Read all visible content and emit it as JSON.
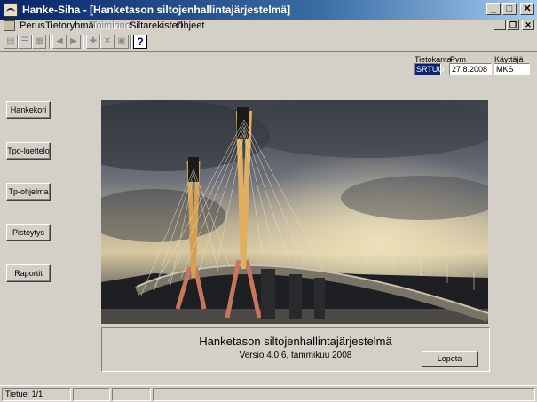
{
  "window": {
    "title": "Hanke-Siha - [Hanketason siltojenhallintajärjestelmä]",
    "app_icon": "bridge-app-icon",
    "controls": {
      "minimize": "_",
      "maximize": "□",
      "close": "✕"
    }
  },
  "menu": {
    "items": [
      "Perus",
      "Tietoryhmät",
      "Toiminnot",
      "Siltarekisteri",
      "Ohjeet"
    ],
    "disabled_item": "Toiminnot",
    "mdi_controls": {
      "minimize": "_",
      "restore": "❐",
      "close": "✕"
    }
  },
  "toolbar": {
    "icons": [
      "report-icon",
      "list-icon",
      "grid-icon",
      "prev-icon",
      "next-icon",
      "add-icon",
      "delete-icon",
      "save-icon",
      "help-icon"
    ],
    "glyphs": {
      "prev": "◀",
      "next": "▶",
      "add": "✚",
      "delete": "✕",
      "save": "▣",
      "help": "?"
    }
  },
  "session": {
    "database_label": "Tietokanta",
    "database_value": "SRTUO",
    "date_label": "Pvm",
    "date_value": "27.8.2008",
    "user_label": "Käyttäjä",
    "user_value": "MKS"
  },
  "sidebar": {
    "buttons": [
      "Hankekori",
      "Tpo-luettelo",
      "Tp-ohjelma",
      "Pisteytys",
      "Raportit"
    ]
  },
  "main": {
    "image_description_icon": "bridge-photo",
    "system_title": "Hanketason siltojenhallintajärjestelmä",
    "version": "Versio 4.0.6, tammikuu 2008",
    "exit_button": "Lopeta"
  },
  "statusbar": {
    "record": "Tietue: 1/1"
  }
}
